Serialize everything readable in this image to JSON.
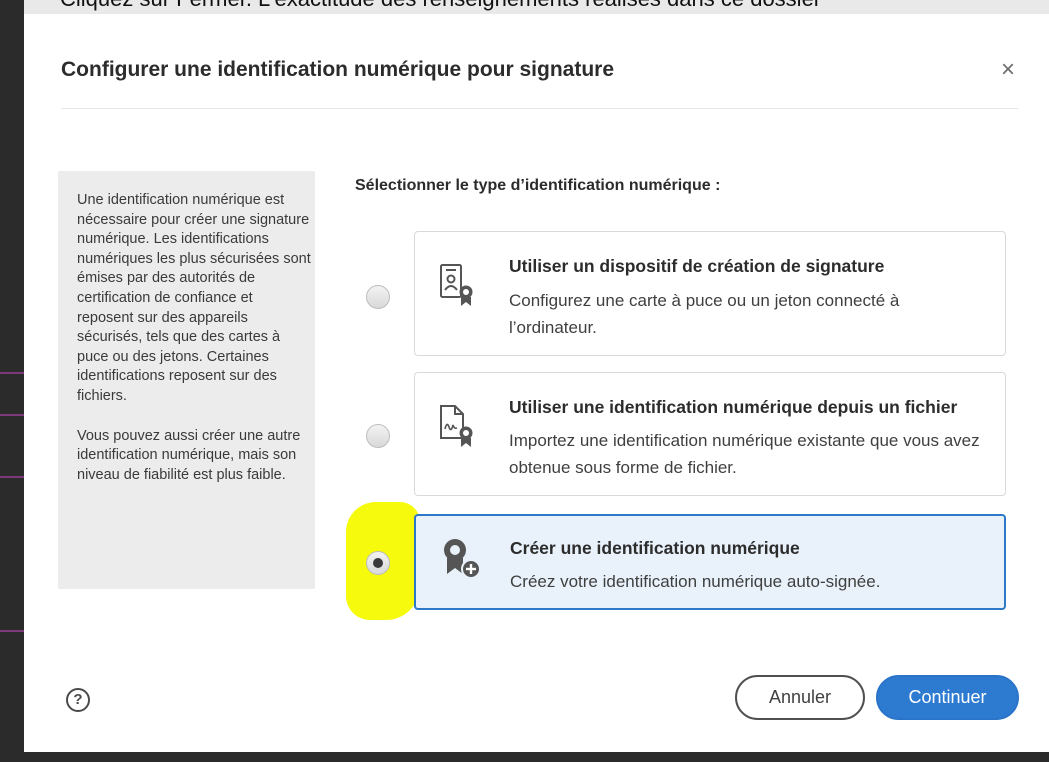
{
  "backdrop": {
    "cut_text": "Cliquez sur Fermer. L'exactitude des renseignements réalisés dans ce dossier"
  },
  "dialog": {
    "title": "Configurer une identification numérique pour signature",
    "close_glyph": "×"
  },
  "info_panel": {
    "paragraph_1": "Une identification numérique est nécessaire pour créer une signature numérique. Les identifications numériques les plus sécurisées sont émises par des autorités de certification de confiance et reposent sur des appareils sécurisés, tels que des cartes à puce ou des jetons. Certaines identifications reposent sur des fichiers.",
    "paragraph_2": "Vous pouvez aussi créer une autre identification numérique, mais son niveau de fiabilité est plus faible."
  },
  "section_label": "Sélectionner le type d’identification numérique :",
  "options": [
    {
      "title": "Utiliser un dispositif de création de signature",
      "description": "Configurez une carte à puce ou un jeton connecté à l’ordinateur.",
      "icon": "smartcard-badge-icon",
      "selected": false
    },
    {
      "title": "Utiliser une identification numérique depuis un fichier",
      "description": "Importez une identification numérique existante que vous avez obtenue sous forme de fichier.",
      "icon": "file-signature-badge-icon",
      "selected": false
    },
    {
      "title": "Créer une identification numérique",
      "description": "Créez votre identification numérique auto-signée.",
      "icon": "create-badge-icon",
      "selected": true
    }
  ],
  "footer": {
    "help_glyph": "?",
    "cancel_label": "Annuler",
    "continue_label": "Continuer"
  },
  "colors": {
    "accent": "#2d7ad1",
    "selected_bg": "#e9f2fb",
    "highlight": "#f6fb00"
  }
}
